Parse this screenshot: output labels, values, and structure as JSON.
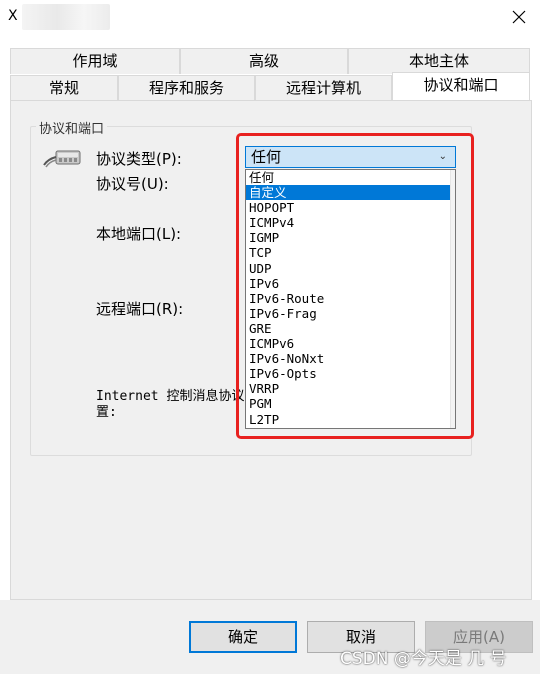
{
  "window": {
    "title_initial": "X",
    "close_glyph": "×"
  },
  "tabs": {
    "row1": [
      "作用域",
      "高级",
      "本地主体"
    ],
    "row2": [
      "常规",
      "程序和服务",
      "远程计算机",
      "协议和端口"
    ],
    "active": "协议和端口"
  },
  "group": {
    "legend": "协议和端口",
    "protocol_type_label": "协议类型(P):",
    "protocol_number_label": "协议号(U):",
    "local_port_label": "本地端口(L):",
    "remote_port_label": "远程端口(R):",
    "icmp_label_line1": "Internet 控制消息协议",
    "icmp_label_line2": "置:"
  },
  "protocol_combo": {
    "selected_value": "任何",
    "arrow": "⌄",
    "options": [
      "任何",
      "自定义",
      "HOPOPT",
      "ICMPv4",
      "IGMP",
      "TCP",
      "UDP",
      "IPv6",
      "IPv6-Route",
      "IPv6-Frag",
      "GRE",
      "ICMPv6",
      "IPv6-NoNxt",
      "IPv6-Opts",
      "VRRP",
      "PGM",
      "L2TP"
    ],
    "highlighted": "自定义"
  },
  "buttons": {
    "ok": "确定",
    "cancel": "取消",
    "apply": "应用(A)"
  },
  "watermark": "CSDN @今天是 几 号",
  "colors": {
    "accent": "#0078d7",
    "highlight_box": "#e8211f",
    "combo_bg": "#cce4f7"
  }
}
